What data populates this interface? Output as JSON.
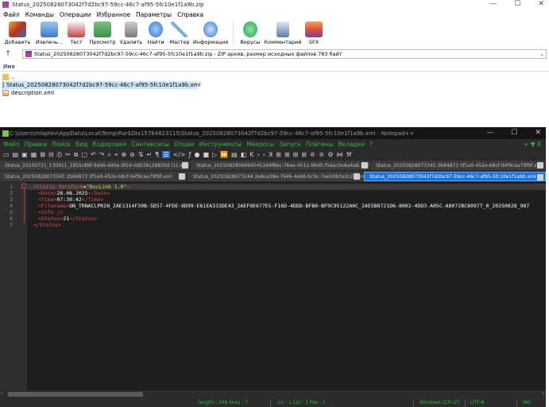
{
  "winrar": {
    "title": "Status_20250828073042f7d2bc97-59cc-46c7-af95-5fc10e1f1a9b.zip",
    "menu": [
      "Файл",
      "Команды",
      "Операции",
      "Избранное",
      "Параметры",
      "Справка"
    ],
    "toolbar": [
      {
        "label": "Добавить",
        "icon": "add-archive-icon",
        "color": "#e6a93a"
      },
      {
        "label": "Извлечь...",
        "icon": "extract-icon",
        "color": "#3f78c9"
      },
      {
        "label": "Тест",
        "icon": "test-icon",
        "color": "#c94040"
      },
      {
        "label": "Просмотр",
        "icon": "view-icon",
        "color": "#3b8f4a"
      },
      {
        "label": "Удалить",
        "icon": "delete-icon",
        "color": "#7a7a7a"
      },
      {
        "label": "Найти",
        "icon": "find-icon",
        "color": "#2d6fd2"
      },
      {
        "label": "Мастер",
        "icon": "wizard-icon",
        "color": "#7ab0e0"
      },
      {
        "label": "Информация",
        "icon": "info-icon",
        "color": "#2f77d0"
      },
      {
        "label": "Вирусы",
        "icon": "virus-scan-icon",
        "color": "#21a34a"
      },
      {
        "label": "Комментарий",
        "icon": "comment-icon",
        "color": "#5a7da8"
      },
      {
        "label": "SFX",
        "icon": "sfx-icon",
        "color": "#d9533a"
      }
    ],
    "address": "Status_20250828073042f7d2bc97-59cc-46c7-af95-5fc10e1f1a9b.zip - ZIP архив, размер исходных файлов 783 байт",
    "list_header": "Имя",
    "files": [
      "..",
      "Status_20250828073042f7d2bc97-59cc-46c7-af95-5fc10e1f1a9b.xml",
      "description.xml"
    ]
  },
  "npp": {
    "title": "C:\\Users\\mlaptev\\AppData\\Local\\Temp\\Rar$DIa15764823115\\Status_20250828073042f7d2bc97-59cc-46c7-af95-5fc10e1f1a9b.xml - Notepad++",
    "menu": [
      "Файл",
      "Правка",
      "Поиск",
      "Вид",
      "Кодировки",
      "Синтаксисы",
      "Опции",
      "Инструменты",
      "Макросы",
      "Запуск",
      "Плагины",
      "Вкладки",
      "?"
    ],
    "menu_right": "+ ▼ X",
    "tabs_row1": [
      "Status_20250721_130911_1855c89f-9d46-490e-9f24-0d536c28830d (1).xml",
      "Status_20250828064945453d4f8ec-76ee-4511-96d5-f5eac5e8a4a8.xml",
      "Status_20250828073345 2b84873 0f1e0-452e-b8cf-94f9cae79f9f.xml"
    ],
    "tabs_row2": [
      "Status_20250828073345 2b84873 0f1e0-452e-b8cf-94f9cae79f9f.xml",
      "Status_20250828073244 2e8ce384-7646-4eb6-bc9c-7ee50b3e3c22.xml",
      "Status_20250828073042f7d2bc97-59cc-46c7-af95-5fc10e1f1a9b.xml"
    ],
    "line_numbers": [
      "1",
      "2",
      "3",
      "4",
      "5",
      "6",
      "7"
    ],
    "code": {
      "root_tag": "<Status",
      "version_attr": "VersForm",
      "version_val": "\"DocLink 1.0\"",
      "date_open": "<Date>",
      "date": "28.08.2025",
      "date_close": "</Date>",
      "time_open": "<Time>",
      "time": "07:30:42",
      "time_close": "</Time>",
      "filename_open": "<Filename>",
      "filename": "ON_TRNACLPRIN_2AE1314F39B-5D57-4FDE-8D99-E61EA333DE43_2AEF9E677E5-F16D-4DDD-BFB0-BF9C95122A0C_2AE5B8721D6-8002-4DD3-A05C-A8072BC80977_0_20250828_987",
      "info": "<Info />",
      "status_open": "<Status>",
      "status": "21",
      "status_close": "</Status>",
      "root_close": "</Status>"
    },
    "status": {
      "length": "length : 349   lines : 7",
      "pos": "Ln : 1   Col : 1   Pos : 1",
      "eol": "Windows (CR LF)",
      "enc": "UTF-8",
      "mode": "INS"
    },
    "colors": {
      "menu_green": "#25c03a",
      "tag_red": "#e04b4b",
      "attr_value": "#f5d046"
    }
  }
}
